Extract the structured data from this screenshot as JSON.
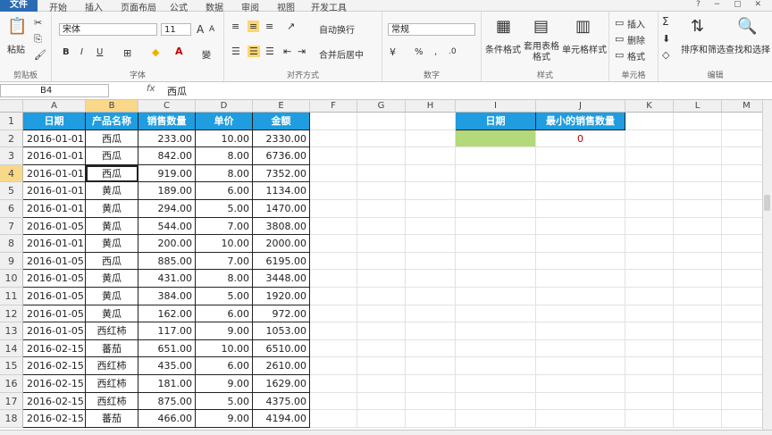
{
  "tabs": [
    "文件",
    "开始",
    "插入",
    "页面布局",
    "公式",
    "数据",
    "审阅",
    "视图",
    "开发工具"
  ],
  "window_controls": "? − ▢ ✕",
  "ribbon": {
    "clipboard": {
      "paste": "粘贴",
      "label": "剪贴板"
    },
    "font": {
      "name": "宋体",
      "size": "11",
      "label": "字体",
      "bold": "B",
      "italic": "I",
      "underline": "U",
      "grow": "A",
      "shrink": "A",
      "wen": "變"
    },
    "alignment": {
      "wrap": "自动换行",
      "merge": "合并后居中",
      "label": "对齐方式"
    },
    "number": {
      "format": "常规",
      "percent": "%",
      "comma": ",",
      "label": "数字"
    },
    "styles": {
      "cond": "条件格式",
      "table": "套用表格格式",
      "cell": "单元格样式",
      "label": "样式"
    },
    "cells": {
      "insert": "插入",
      "delete": "删除",
      "format": "格式",
      "label": "单元格"
    },
    "editing": {
      "sum": "Σ",
      "sort": "排序和筛选",
      "find": "查找和选择",
      "label": "编辑"
    }
  },
  "formula_bar": {
    "name_box": "B4",
    "fx": "fx",
    "value": "西瓜"
  },
  "columns": [
    "A",
    "B",
    "C",
    "D",
    "E",
    "F",
    "G",
    "H",
    "I",
    "J",
    "K",
    "L",
    "M",
    "N"
  ],
  "rows": [
    "1",
    "2",
    "3",
    "4",
    "5",
    "6",
    "7",
    "8",
    "9",
    "10",
    "11",
    "12",
    "13",
    "14",
    "15",
    "16",
    "17",
    "18"
  ],
  "headers": [
    "日期",
    "产品名称",
    "销售数量",
    "单价",
    "金额"
  ],
  "data": [
    [
      "2016-01-01",
      "西瓜",
      "233.00",
      "10.00",
      "2330.00"
    ],
    [
      "2016-01-01",
      "西瓜",
      "842.00",
      "8.00",
      "6736.00"
    ],
    [
      "2016-01-01",
      "西瓜",
      "919.00",
      "8.00",
      "7352.00"
    ],
    [
      "2016-01-01",
      "黄瓜",
      "189.00",
      "6.00",
      "1134.00"
    ],
    [
      "2016-01-01",
      "黄瓜",
      "294.00",
      "5.00",
      "1470.00"
    ],
    [
      "2016-01-05",
      "黄瓜",
      "544.00",
      "7.00",
      "3808.00"
    ],
    [
      "2016-01-01",
      "黄瓜",
      "200.00",
      "10.00",
      "2000.00"
    ],
    [
      "2016-01-05",
      "西瓜",
      "885.00",
      "7.00",
      "6195.00"
    ],
    [
      "2016-01-05",
      "黄瓜",
      "431.00",
      "8.00",
      "3448.00"
    ],
    [
      "2016-01-05",
      "黄瓜",
      "384.00",
      "5.00",
      "1920.00"
    ],
    [
      "2016-01-05",
      "黄瓜",
      "162.00",
      "6.00",
      "972.00"
    ],
    [
      "2016-01-05",
      "西红柿",
      "117.00",
      "9.00",
      "1053.00"
    ],
    [
      "2016-02-15",
      "蕃茄",
      "651.00",
      "10.00",
      "6510.00"
    ],
    [
      "2016-02-15",
      "西红柿",
      "435.00",
      "6.00",
      "2610.00"
    ],
    [
      "2016-02-15",
      "西红柿",
      "181.00",
      "9.00",
      "1629.00"
    ],
    [
      "2016-02-15",
      "西红柿",
      "875.00",
      "5.00",
      "4375.00"
    ],
    [
      "2016-02-15",
      "蕃茄",
      "466.00",
      "9.00",
      "4194.00"
    ]
  ],
  "side_table": {
    "headers": [
      "日期",
      "最小的销售数量"
    ],
    "value": "0"
  },
  "colors": {
    "header_blue": "#1f9de0",
    "green_cell": "#b3d97a",
    "red_value": "#c00000"
  }
}
